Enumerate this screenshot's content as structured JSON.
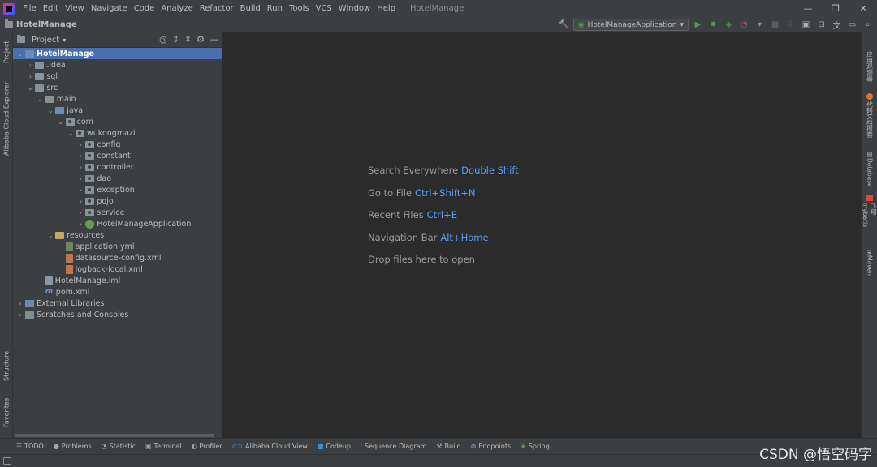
{
  "titlebar": {
    "menu": [
      "File",
      "Edit",
      "View",
      "Navigate",
      "Code",
      "Analyze",
      "Refactor",
      "Build",
      "Run",
      "Tools",
      "VCS",
      "Window",
      "Help"
    ],
    "title": "HotelManage",
    "min": "—",
    "restore": "❐",
    "close": "✕"
  },
  "navbar": {
    "project": "HotelManage",
    "run_config": "HotelManageApplication"
  },
  "left_strip": {
    "project": "Project",
    "cloud_explorer": "Alibaba Cloud Explorer",
    "structure": "Structure",
    "favorites": "Favorites"
  },
  "project_panel": {
    "title": "Project",
    "tree": [
      {
        "label": "HotelManage",
        "indent": 0,
        "expanded": true,
        "icon": "folder-blue",
        "selected": true
      },
      {
        "label": ".idea",
        "indent": 1,
        "expanded": false,
        "icon": "folder"
      },
      {
        "label": "sql",
        "indent": 1,
        "expanded": false,
        "icon": "folder"
      },
      {
        "label": "src",
        "indent": 1,
        "expanded": true,
        "icon": "folder"
      },
      {
        "label": "main",
        "indent": 2,
        "expanded": true,
        "icon": "folder"
      },
      {
        "label": "java",
        "indent": 3,
        "expanded": true,
        "icon": "folder-blue"
      },
      {
        "label": "com",
        "indent": 4,
        "expanded": true,
        "icon": "pkg"
      },
      {
        "label": "wukongmazi",
        "indent": 5,
        "expanded": true,
        "icon": "pkg"
      },
      {
        "label": "config",
        "indent": 6,
        "expanded": false,
        "icon": "pkg"
      },
      {
        "label": "constant",
        "indent": 6,
        "expanded": false,
        "icon": "pkg"
      },
      {
        "label": "controller",
        "indent": 6,
        "expanded": false,
        "icon": "pkg"
      },
      {
        "label": "dao",
        "indent": 6,
        "expanded": false,
        "icon": "pkg"
      },
      {
        "label": "exception",
        "indent": 6,
        "expanded": false,
        "icon": "pkg"
      },
      {
        "label": "pojo",
        "indent": 6,
        "expanded": false,
        "icon": "pkg"
      },
      {
        "label": "service",
        "indent": 6,
        "expanded": false,
        "icon": "pkg"
      },
      {
        "label": "HotelManageApplication",
        "indent": 6,
        "expanded": false,
        "icon": "spring"
      },
      {
        "label": "resources",
        "indent": 3,
        "expanded": true,
        "icon": "res"
      },
      {
        "label": "application.yml",
        "indent": 4,
        "icon": "file-yml"
      },
      {
        "label": "datasource-config.xml",
        "indent": 4,
        "icon": "file-xml"
      },
      {
        "label": "logback-local.xml",
        "indent": 4,
        "icon": "file-xml"
      },
      {
        "label": "HotelManage.iml",
        "indent": 2,
        "icon": "file-iml"
      },
      {
        "label": "pom.xml",
        "indent": 2,
        "icon": "maven"
      },
      {
        "label": "External Libraries",
        "indent": 0,
        "expanded": false,
        "icon": "lib"
      },
      {
        "label": "Scratches and Consoles",
        "indent": 0,
        "expanded": false,
        "icon": "scratch"
      }
    ]
  },
  "editor": {
    "hints": [
      {
        "text": "Search Everywhere",
        "key": "Double Shift"
      },
      {
        "text": "Go to File",
        "key": "Ctrl+Shift+N"
      },
      {
        "text": "Recent Files",
        "key": "Ctrl+E"
      },
      {
        "text": "Navigation Bar",
        "key": "Alt+Home"
      },
      {
        "text": "Drop files here to open",
        "key": ""
      }
    ]
  },
  "right_strip": {
    "tab1": "应用观测器",
    "tab2": "代码文档搜索",
    "database": "Database",
    "tab4": "飞翔mybatis",
    "maven": "Maven"
  },
  "bottombar": {
    "items": [
      "TODO",
      "Problems",
      "Statistic",
      "Terminal",
      "Profiler",
      "Alibaba Cloud View",
      "Codeup",
      "Sequence Diagram",
      "Build",
      "Endpoints",
      "Spring"
    ]
  },
  "watermark": "CSDN @悟空码字",
  "colors": {
    "selection": "#4b6eaf",
    "shortcut_key": "#589df6",
    "run_green": "#499c54"
  }
}
